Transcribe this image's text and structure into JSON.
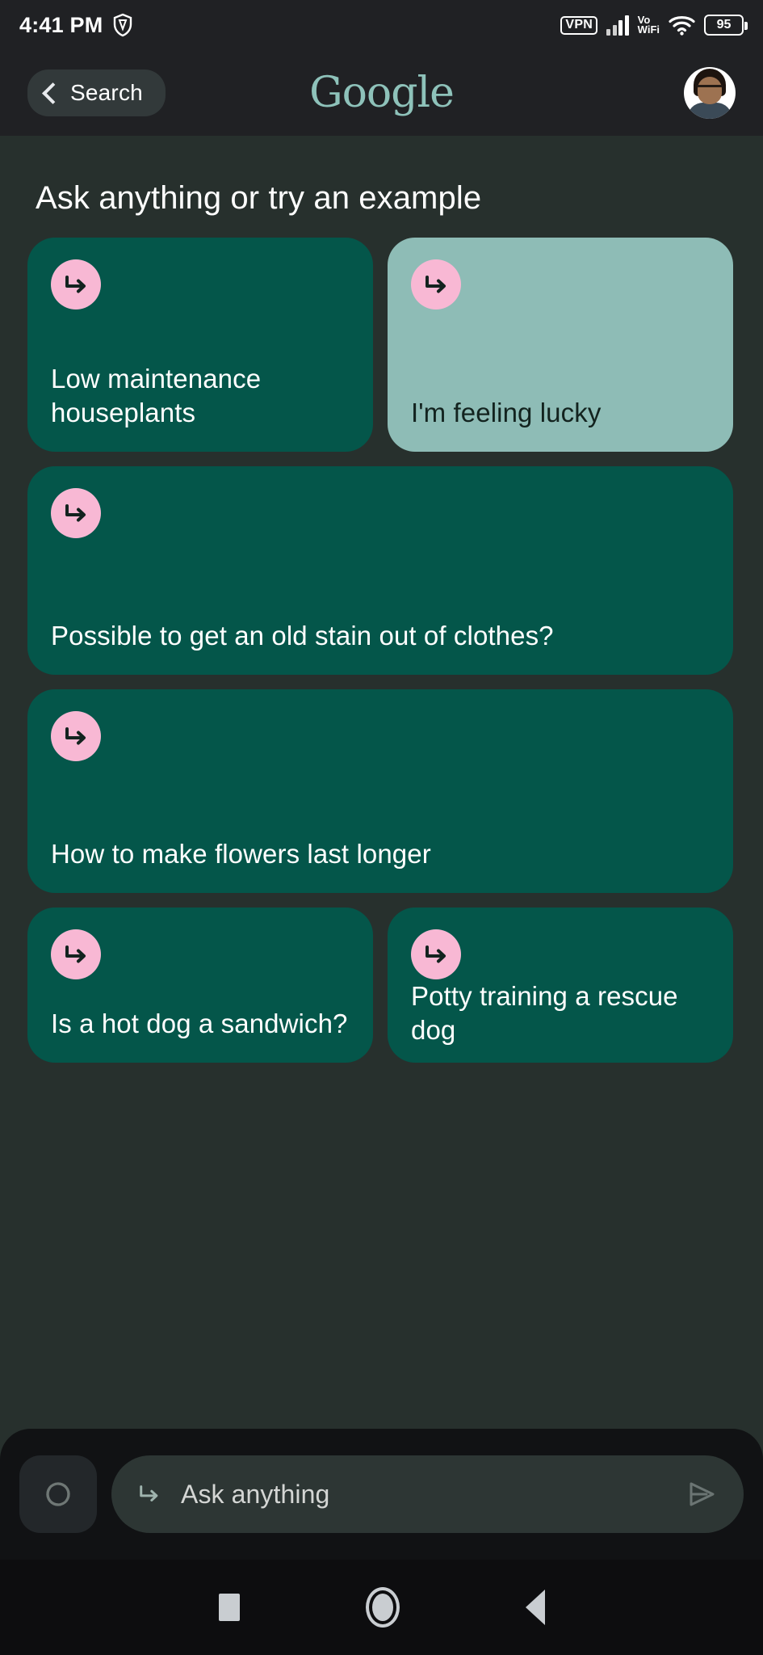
{
  "status_bar": {
    "time": "4:41 PM",
    "shield_icon": "shield-icon",
    "vpn_label": "VPN",
    "signal_icon": "cellular-signal-icon",
    "vowifi_line1": "Vo",
    "vowifi_line2": "WiFi",
    "wifi_icon": "wifi-icon",
    "battery_level": "95"
  },
  "app_bar": {
    "back_label": "Search",
    "logo_text": "Google",
    "avatar_name": "user-avatar"
  },
  "main": {
    "heading": "Ask anything or try an example",
    "cards": [
      {
        "text": "Low maintenance houseplants",
        "style": "dark",
        "size": "half"
      },
      {
        "text": "I'm feeling lucky",
        "style": "light",
        "size": "half"
      },
      {
        "text": "Possible to get an old stain out of clothes?",
        "style": "dark",
        "size": "full"
      },
      {
        "text": "How to make flowers last longer",
        "style": "dark",
        "size": "full"
      },
      {
        "text": "Is a hot dog a sandwich?",
        "style": "dark",
        "size": "half"
      },
      {
        "text": "Potty training a rescue dog",
        "style": "dark",
        "size": "half"
      }
    ]
  },
  "dock": {
    "refresh_icon": "refresh-icon",
    "prompt_icon": "arrow-turn-right-icon",
    "placeholder": "Ask anything",
    "send_icon": "send-icon"
  },
  "nav_bar": {
    "recents_icon": "recents-square-icon",
    "home_icon": "home-circle-icon",
    "back_icon": "back-triangle-icon"
  },
  "colors": {
    "card_dark": "#04564A",
    "card_light": "#8EBCB6",
    "bubble_pink": "#F8B8D4",
    "logo_teal": "#8EC2BA",
    "page_bg": "#27302D",
    "bar_bg": "#202124"
  }
}
